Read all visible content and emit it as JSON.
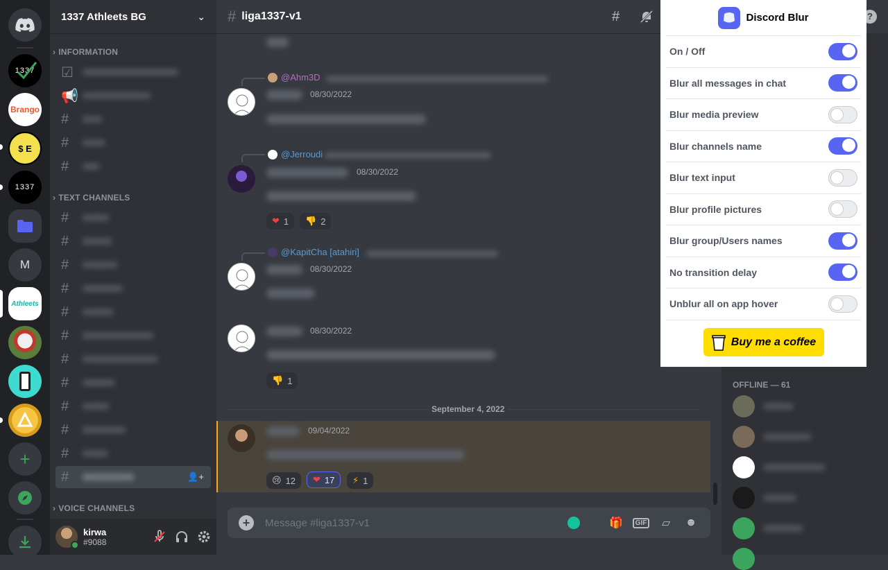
{
  "server": {
    "name": "1337 Athleets BG",
    "servers": [
      {
        "name": "discord-home",
        "icon": "discord-icon"
      },
      {
        "name": "1337-check",
        "label": "1337"
      },
      {
        "name": "brango",
        "label": "Brango"
      },
      {
        "name": "smiley-money",
        "label": "$ E"
      },
      {
        "name": "leet",
        "label": "1337"
      },
      {
        "name": "folder",
        "icon": "folder-icon"
      },
      {
        "name": "m-server",
        "label": "M"
      },
      {
        "name": "athleets",
        "label": "Athleets"
      },
      {
        "name": "helmet"
      },
      {
        "name": "phone"
      },
      {
        "name": "gold-coin"
      },
      {
        "name": "add-server",
        "icon": "plus-icon"
      },
      {
        "name": "explore",
        "icon": "compass-icon"
      },
      {
        "name": "download",
        "icon": "download-icon"
      }
    ]
  },
  "categories": {
    "information": "INFORMATION",
    "text": "TEXT CHANNELS",
    "voice": "VOICE CHANNELS"
  },
  "chat": {
    "channel": "liga1337-v1",
    "date_divider": "September 4, 2022",
    "placeholder": "Message #liga1337-v1",
    "messages": [
      {
        "reply_to": "@Ahm3D",
        "date": "08/30/2022"
      },
      {
        "reply_to": "@Jerroudi",
        "date": "08/30/2022",
        "reactions": [
          {
            "emoji": "❤",
            "count": "1"
          },
          {
            "emoji": "👎",
            "count": "2"
          }
        ]
      },
      {
        "reply_to": "@KapitCha [atahiri]",
        "date": "08/30/2022"
      },
      {
        "date": "08/30/2022",
        "reactions": [
          {
            "emoji": "👎",
            "count": "1"
          }
        ]
      },
      {
        "date": "09/04/2022",
        "reactions": [
          {
            "emoji": "😢",
            "count": "12"
          },
          {
            "emoji": "❤",
            "count": "17"
          },
          {
            "emoji": "⚡",
            "count": "1"
          }
        ]
      }
    ]
  },
  "members": {
    "offline_label": "OFFLINE — 61"
  },
  "user": {
    "name": "kirwa",
    "tag": "#9088"
  },
  "popup": {
    "title": "Discord Blur",
    "options": [
      {
        "label": "On / Off",
        "on": true
      },
      {
        "label": "Blur all messages in chat",
        "on": true
      },
      {
        "label": "Blur media preview",
        "on": false
      },
      {
        "label": "Blur channels name",
        "on": true
      },
      {
        "label": "Blur text input",
        "on": false
      },
      {
        "label": "Blur profile pictures",
        "on": false
      },
      {
        "label": "Blur group/Users names",
        "on": true
      },
      {
        "label": "No transition delay",
        "on": true
      },
      {
        "label": "Unblur all on app hover",
        "on": false
      }
    ],
    "coffee_label": "Buy me a coffee"
  },
  "colors": {
    "accent": "#5865f2",
    "highlight_border": "#faa81a",
    "coffee": "#ffdd00"
  }
}
